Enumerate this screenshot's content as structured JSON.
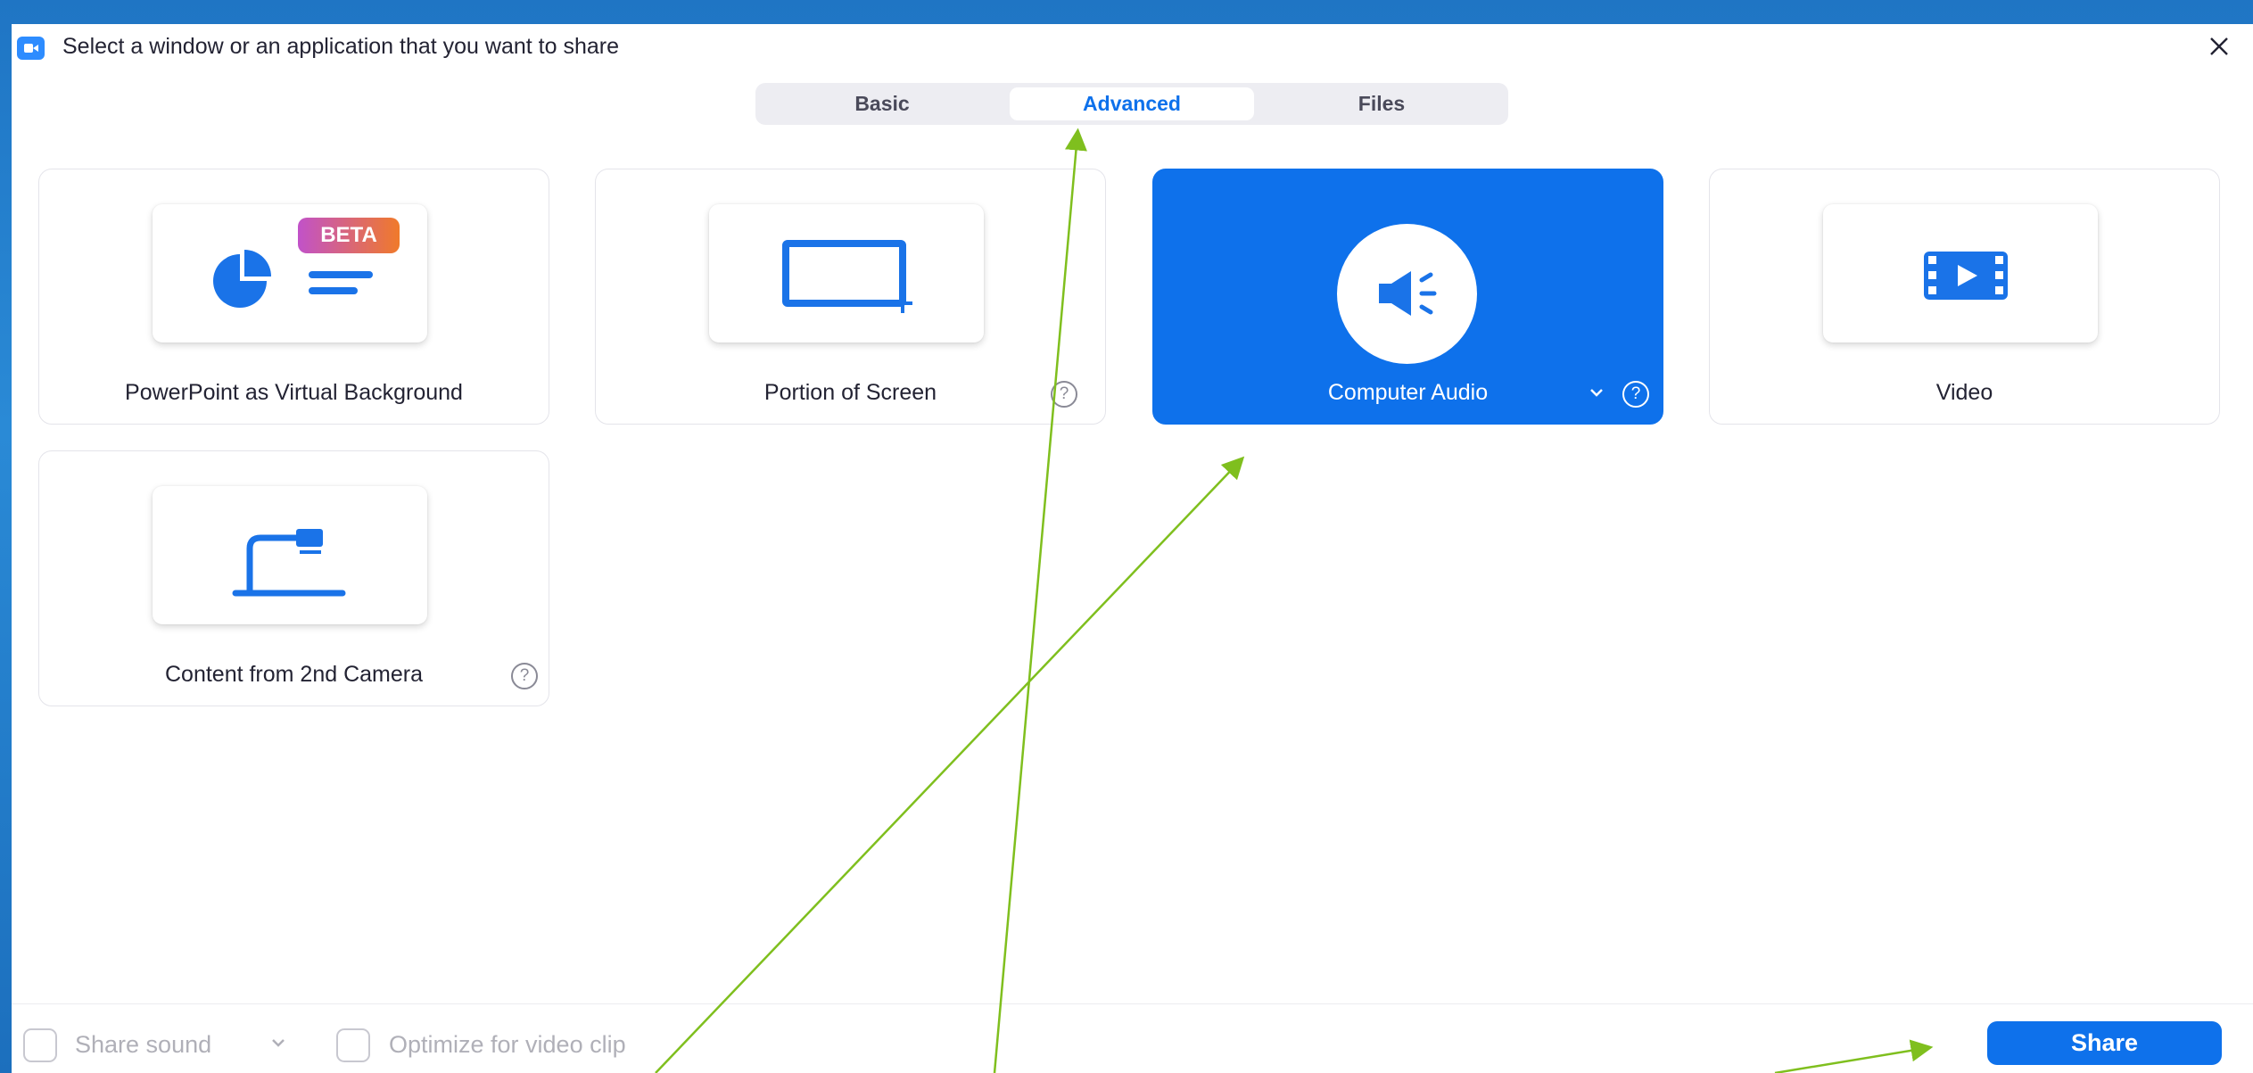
{
  "window": {
    "title": "Select a window or an application that you want to share",
    "close_icon": "close-icon",
    "app_icon": "zoom-camera-icon"
  },
  "tabs": [
    {
      "label": "Basic",
      "active": false
    },
    {
      "label": "Advanced",
      "active": true
    },
    {
      "label": "Files",
      "active": false
    }
  ],
  "options": [
    {
      "label": "PowerPoint as Virtual Background",
      "badge": "BETA",
      "icon": "powerpoint-pie-chart-icon",
      "help": false,
      "selected": false
    },
    {
      "label": "Portion of Screen",
      "icon": "screen-portion-icon",
      "help": true,
      "help_glyph": "?",
      "selected": false
    },
    {
      "label": "Computer Audio",
      "icon": "speaker-icon",
      "help": true,
      "help_glyph": "?",
      "dropdown": true,
      "selected": true
    },
    {
      "label": "Video",
      "icon": "film-icon",
      "help": false,
      "selected": false
    },
    {
      "label": "Content from 2nd Camera",
      "icon": "document-camera-icon",
      "help": true,
      "help_glyph": "?",
      "selected": false
    }
  ],
  "footer": {
    "share_sound_label": "Share sound",
    "share_sound_checked": false,
    "optimize_label": "Optimize for video clip",
    "optimize_checked": false,
    "share_button_label": "Share"
  },
  "colors": {
    "accent": "#0e71eb",
    "annotation_arrow": "#7fbf1e",
    "beta_gradient_start": "#c152c9",
    "beta_gradient_end": "#f07a2a"
  }
}
